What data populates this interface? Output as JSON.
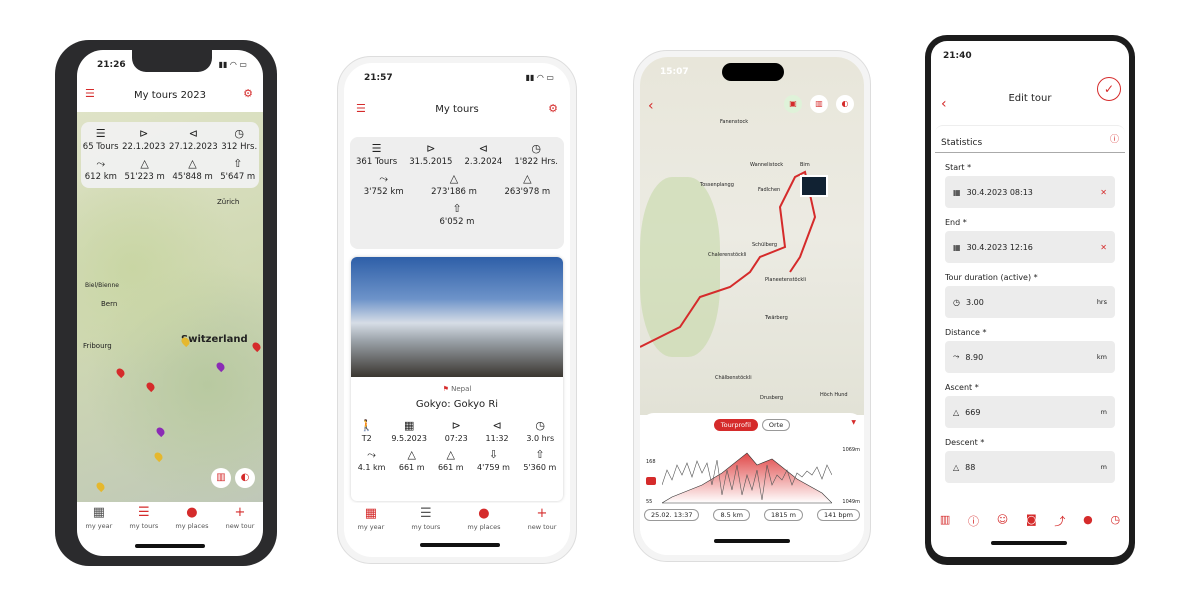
{
  "phone1": {
    "time": "21:26",
    "title": "My tours 2023",
    "stats": [
      {
        "icon": "list-icon",
        "value": "65 Tours"
      },
      {
        "icon": "start-icon",
        "value": "22.1.2023"
      },
      {
        "icon": "end-icon",
        "value": "27.12.2023"
      },
      {
        "icon": "clock-icon",
        "value": "312 Hrs."
      },
      {
        "icon": "distance-icon",
        "value": "612 km"
      },
      {
        "icon": "ascent-icon",
        "value": "51'223 m"
      },
      {
        "icon": "descent-icon",
        "value": "45'848 m"
      },
      {
        "icon": "highest-icon",
        "value": "5'647 m"
      }
    ],
    "map_labels": [
      "Zürich",
      "Bern",
      "Fribourg",
      "Switzerland",
      "Biel/Bienne"
    ],
    "nav": [
      "my year",
      "my tours",
      "my places",
      "new tour"
    ]
  },
  "phone2": {
    "time": "21:57",
    "title": "My tours",
    "stats": [
      {
        "icon": "list-icon",
        "value": "361 Tours"
      },
      {
        "icon": "start-icon",
        "value": "31.5.2015"
      },
      {
        "icon": "end-icon",
        "value": "2.3.2024"
      },
      {
        "icon": "clock-icon",
        "value": "1'822 Hrs."
      },
      {
        "icon": "distance-icon",
        "value": "3'752 km"
      },
      {
        "icon": "ascent-icon",
        "value": "273'186 m"
      },
      {
        "icon": "descent-icon",
        "value": "263'978 m"
      },
      {
        "icon": "highest-icon",
        "value": "6'052 m"
      }
    ],
    "tour": {
      "country": "Nepal",
      "name": "Gokyo: Gokyo Ri",
      "row1": [
        {
          "icon": "hiker-icon",
          "value": "T2"
        },
        {
          "icon": "calendar-icon",
          "value": "9.5.2023"
        },
        {
          "icon": "start-icon",
          "value": "07:23"
        },
        {
          "icon": "end-icon",
          "value": "11:32"
        },
        {
          "icon": "clock-icon",
          "value": "3.0 hrs"
        }
      ],
      "row2": [
        {
          "icon": "distance-icon",
          "value": "4.1 km"
        },
        {
          "icon": "ascent-icon",
          "value": "661 m"
        },
        {
          "icon": "descent-icon",
          "value": "661 m"
        },
        {
          "icon": "lowest-icon",
          "value": "4'759 m"
        },
        {
          "icon": "highest-icon",
          "value": "5'360 m"
        }
      ]
    },
    "nav": [
      "my year",
      "my tours",
      "my places",
      "new tour"
    ]
  },
  "phone3": {
    "time": "15:07",
    "tabs": [
      "Tourprofil",
      "Orte"
    ],
    "chart_left": [
      "168",
      "55"
    ],
    "chart_right": [
      "1069m",
      "1049m"
    ],
    "pills": [
      "25.02. 13:37",
      "8.5 km",
      "1815 m",
      "141 bpm"
    ],
    "map_labels": [
      "Fanenstock",
      "Wannelistock",
      "Bim",
      "Tossenplangg",
      "Fadlchen",
      "Schülberg",
      "Chalerenstöckli",
      "Planeetenstöckli",
      "Twärberg",
      "Chälbenstöckli",
      "Drusberg",
      "Höch Hund"
    ]
  },
  "phone4": {
    "time": "21:40",
    "title": "Edit tour",
    "section": "Statistics",
    "fields": [
      {
        "label": "Start *",
        "icon": "calendar-icon",
        "value": "30.4.2023 08:13",
        "clear": true,
        "unit": ""
      },
      {
        "label": "End *",
        "icon": "calendar-icon",
        "value": "30.4.2023 12:16",
        "clear": true,
        "unit": ""
      },
      {
        "label": "Tour duration (active) *",
        "icon": "clock-icon",
        "value": "3.00",
        "unit": "hrs"
      },
      {
        "label": "Distance *",
        "icon": "distance-icon",
        "value": "8.90",
        "unit": "km"
      },
      {
        "label": "Ascent *",
        "icon": "ascent-icon",
        "value": "669",
        "unit": "m"
      },
      {
        "label": "Descent *",
        "icon": "descent-icon",
        "value": "88",
        "unit": "m"
      }
    ]
  },
  "colors": {
    "accent": "#d52b2b"
  }
}
